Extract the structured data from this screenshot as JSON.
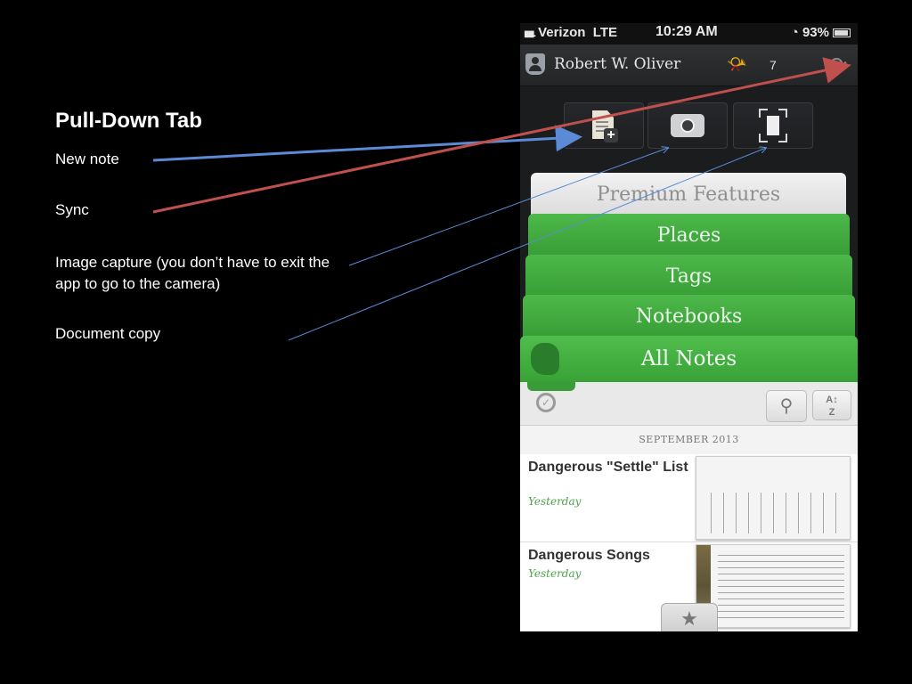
{
  "annotations": {
    "title": "Pull-Down Tab",
    "items": [
      "New note",
      "Sync",
      "Image capture (you don’t have to exit the app to go to the camera)",
      "Document copy"
    ]
  },
  "status_bar": {
    "carrier": "Verizon",
    "network": "LTE",
    "time": "10:29 AM",
    "battery": "93%"
  },
  "header": {
    "username": "Robert W. Oliver",
    "notification_count": "7"
  },
  "tabs": {
    "premium": "Premium Features",
    "places": "Places",
    "tags": "Tags",
    "notebooks": "Notebooks",
    "all_notes": "All Notes"
  },
  "notes": {
    "section": "SEPTEMBER 2013",
    "items": [
      {
        "title": "Dangerous \"Settle\" List",
        "date": "Yesterday"
      },
      {
        "title": "Dangerous Songs",
        "date": "Yesterday"
      }
    ]
  },
  "colors": {
    "arrow_blue": "#5b8bd6",
    "arrow_red": "#c0504d",
    "tab_green": "#3faa3d"
  },
  "icons": {
    "new_note": "new-note-icon",
    "camera": "camera-icon",
    "document": "document-camera-icon",
    "sync": "sync-icon",
    "search": "search-icon",
    "sort": "sort-icon",
    "reminder": "alarm-clock-icon",
    "star": "star-icon"
  }
}
